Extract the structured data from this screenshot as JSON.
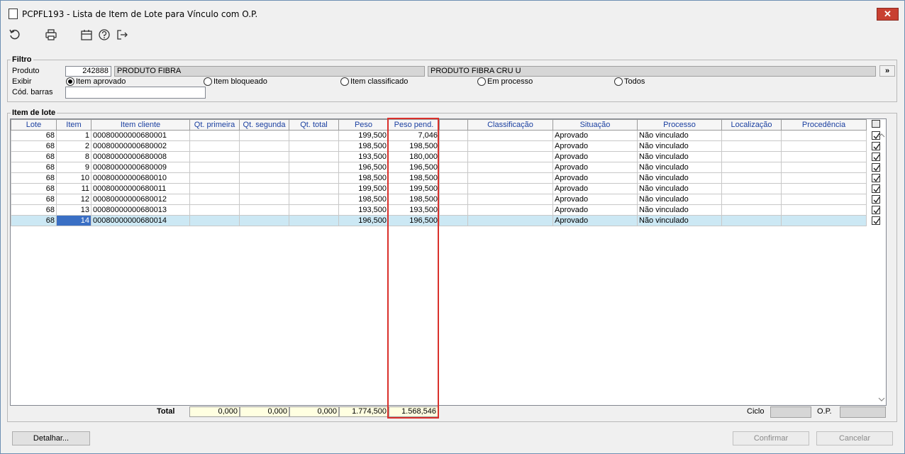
{
  "window": {
    "title": "PCPFL193 - Lista de Item de Lote para Vínculo com O.P.",
    "close_label": "✕"
  },
  "toolbar": {
    "refresh_icon": "refresh-icon",
    "print_icon": "printer-icon",
    "calendar_icon": "calendar-icon",
    "help_icon": "help-icon",
    "exit_icon": "exit-icon"
  },
  "filtro": {
    "legend": "Filtro",
    "produto_label": "Produto",
    "produto_code": "242888",
    "produto_desc": "PRODUTO FIBRA",
    "produto_desc2": "PRODUTO FIBRA CRU U",
    "more_label": "»",
    "exibir_label": "Exibir",
    "options": [
      "Item aprovado",
      "Item bloqueado",
      "Item classificado",
      "Em processo",
      "Todos"
    ],
    "selected": "Item aprovado",
    "cod_barras_label": "Cód. barras",
    "cod_barras_value": ""
  },
  "item_lote": {
    "legend": "Item de lote",
    "columns": [
      "Lote",
      "Item",
      "Item cliente",
      "Qt. primeira",
      "Qt. segunda",
      "Qt. total",
      "Peso",
      "Peso pend.",
      "",
      "Classificação",
      "Situação",
      "Processo",
      "Localização",
      "Procedência"
    ],
    "rows": [
      {
        "lote": "68",
        "item": "1",
        "cliente": "00080000000680001",
        "qt1": "",
        "qt2": "",
        "qtt": "",
        "peso": "199,500",
        "pend": "7,046",
        "x": "",
        "classif": "",
        "situacao": "Aprovado",
        "processo": "Não vinculado",
        "local": "",
        "proc": "",
        "checked": true
      },
      {
        "lote": "68",
        "item": "2",
        "cliente": "00080000000680002",
        "qt1": "",
        "qt2": "",
        "qtt": "",
        "peso": "198,500",
        "pend": "198,500",
        "x": "",
        "classif": "",
        "situacao": "Aprovado",
        "processo": "Não vinculado",
        "local": "",
        "proc": "",
        "checked": true
      },
      {
        "lote": "68",
        "item": "8",
        "cliente": "00080000000680008",
        "qt1": "",
        "qt2": "",
        "qtt": "",
        "peso": "193,500",
        "pend": "180,000",
        "x": "",
        "classif": "",
        "situacao": "Aprovado",
        "processo": "Não vinculado",
        "local": "",
        "proc": "",
        "checked": true
      },
      {
        "lote": "68",
        "item": "9",
        "cliente": "00080000000680009",
        "qt1": "",
        "qt2": "",
        "qtt": "",
        "peso": "196,500",
        "pend": "196,500",
        "x": "",
        "classif": "",
        "situacao": "Aprovado",
        "processo": "Não vinculado",
        "local": "",
        "proc": "",
        "checked": true
      },
      {
        "lote": "68",
        "item": "10",
        "cliente": "00080000000680010",
        "qt1": "",
        "qt2": "",
        "qtt": "",
        "peso": "198,500",
        "pend": "198,500",
        "x": "",
        "classif": "",
        "situacao": "Aprovado",
        "processo": "Não vinculado",
        "local": "",
        "proc": "",
        "checked": true
      },
      {
        "lote": "68",
        "item": "11",
        "cliente": "00080000000680011",
        "qt1": "",
        "qt2": "",
        "qtt": "",
        "peso": "199,500",
        "pend": "199,500",
        "x": "",
        "classif": "",
        "situacao": "Aprovado",
        "processo": "Não vinculado",
        "local": "",
        "proc": "",
        "checked": true
      },
      {
        "lote": "68",
        "item": "12",
        "cliente": "00080000000680012",
        "qt1": "",
        "qt2": "",
        "qtt": "",
        "peso": "198,500",
        "pend": "198,500",
        "x": "",
        "classif": "",
        "situacao": "Aprovado",
        "processo": "Não vinculado",
        "local": "",
        "proc": "",
        "checked": true
      },
      {
        "lote": "68",
        "item": "13",
        "cliente": "00080000000680013",
        "qt1": "",
        "qt2": "",
        "qtt": "",
        "peso": "193,500",
        "pend": "193,500",
        "x": "",
        "classif": "",
        "situacao": "Aprovado",
        "processo": "Não vinculado",
        "local": "",
        "proc": "",
        "checked": true
      },
      {
        "lote": "68",
        "item": "14",
        "cliente": "00080000000680014",
        "qt1": "",
        "qt2": "",
        "qtt": "",
        "peso": "196,500",
        "pend": "196,500",
        "x": "",
        "classif": "",
        "situacao": "Aprovado",
        "processo": "Não vinculado",
        "local": "",
        "proc": "",
        "checked": true
      }
    ],
    "selected_row": 8
  },
  "totals": {
    "label": "Total",
    "qt_primeira": "0,000",
    "qt_segunda": "0,000",
    "qt_total": "0,000",
    "peso": "1.774,500",
    "peso_pend": "1.568,546"
  },
  "footer": {
    "ciclo_label": "Ciclo",
    "ciclo_value": "",
    "op_label": "O.P.",
    "op_value": "",
    "detalhar": "Detalhar...",
    "confirmar": "Confirmar",
    "cancelar": "Cancelar"
  },
  "colors": {
    "highlight": "#d9302b",
    "selected_row": "#cce8f4",
    "header_text": "#1a3fa0",
    "total_bg": "#ffffe1"
  }
}
